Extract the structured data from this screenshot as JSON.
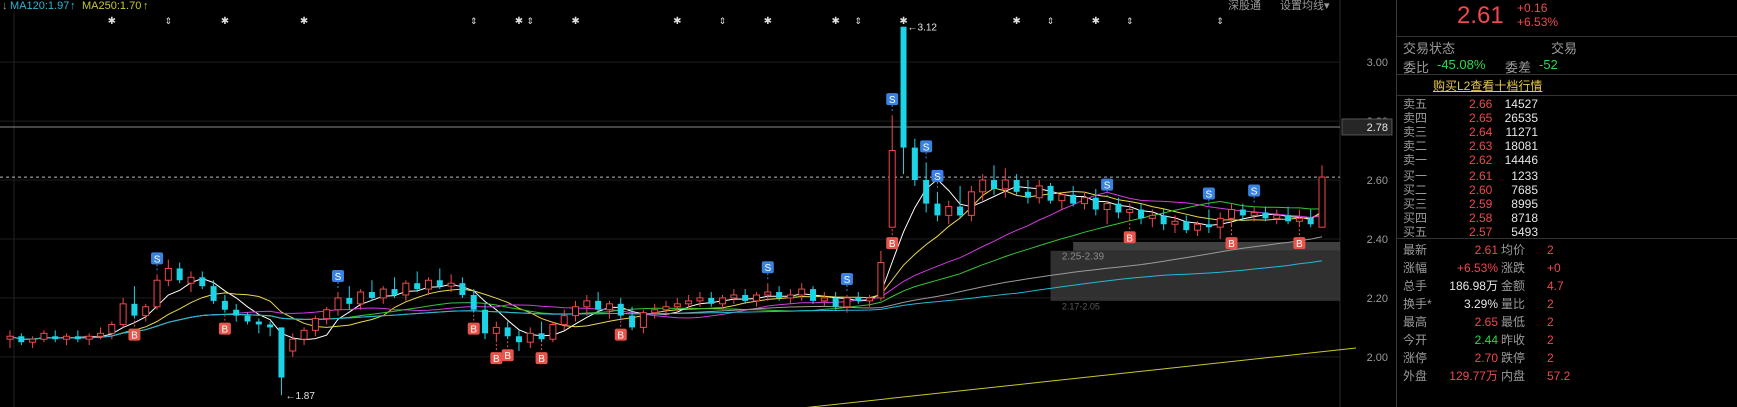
{
  "top_bar": {
    "ma120": "MA120:1.97",
    "ma120_arrow": "↑",
    "ma250": "MA250:1.70",
    "ma250_arrow": "↑",
    "left_arrow": "↓",
    "btn_deep": "深股通",
    "btn_settings": "设置均线",
    "btn_settings_caret": "▾"
  },
  "colors": {
    "up": "#f0484c",
    "down": "#1bd4e6",
    "ma_white": "#ffffff",
    "ma_yellow": "#e8d84a",
    "ma_magenta": "#d23be2",
    "ma_green": "#35c735",
    "ma_grey": "#9a9a9a",
    "ma_cyan": "#24b8d6",
    "ma_long": "#c8c82c",
    "marker_s": "#3a82e0",
    "marker_b": "#e8534a"
  },
  "chart_data": {
    "type": "candlestick",
    "y_ticks": [
      "3.00",
      "2.80",
      "2.60",
      "2.40",
      "2.20",
      "2.00"
    ],
    "y_range": [
      1.83,
      3.17
    ],
    "price_tag": "2.78",
    "annotations": {
      "high": "3.12",
      "low": "1.87",
      "box_label": "2.25-2.39",
      "cost_label": "2.17-2.05"
    },
    "bars": [
      {
        "o": 2.06,
        "h": 2.09,
        "l": 2.03,
        "c": 2.07
      },
      {
        "o": 2.07,
        "h": 2.08,
        "l": 2.04,
        "c": 2.05
      },
      {
        "o": 2.05,
        "h": 2.07,
        "l": 2.03,
        "c": 2.06
      },
      {
        "o": 2.06,
        "h": 2.09,
        "l": 2.05,
        "c": 2.08
      },
      {
        "o": 2.07,
        "h": 2.09,
        "l": 2.05,
        "c": 2.06
      },
      {
        "o": 2.06,
        "h": 2.08,
        "l": 2.04,
        "c": 2.07
      },
      {
        "o": 2.07,
        "h": 2.09,
        "l": 2.05,
        "c": 2.06
      },
      {
        "o": 2.06,
        "h": 2.08,
        "l": 2.04,
        "c": 2.07
      },
      {
        "o": 2.07,
        "h": 2.1,
        "l": 2.06,
        "c": 2.08
      },
      {
        "o": 2.08,
        "h": 2.12,
        "l": 2.06,
        "c": 2.11
      },
      {
        "o": 2.11,
        "h": 2.2,
        "l": 2.1,
        "c": 2.18
      },
      {
        "o": 2.18,
        "h": 2.24,
        "l": 2.13,
        "c": 2.14
      },
      {
        "o": 2.14,
        "h": 2.18,
        "l": 2.12,
        "c": 2.17
      },
      {
        "o": 2.17,
        "h": 2.28,
        "l": 2.16,
        "c": 2.26
      },
      {
        "o": 2.26,
        "h": 2.33,
        "l": 2.24,
        "c": 2.3
      },
      {
        "o": 2.3,
        "h": 2.32,
        "l": 2.25,
        "c": 2.26
      },
      {
        "o": 2.25,
        "h": 2.29,
        "l": 2.22,
        "c": 2.27
      },
      {
        "o": 2.27,
        "h": 2.29,
        "l": 2.23,
        "c": 2.24
      },
      {
        "o": 2.24,
        "h": 2.26,
        "l": 2.18,
        "c": 2.19
      },
      {
        "o": 2.19,
        "h": 2.21,
        "l": 2.15,
        "c": 2.16
      },
      {
        "o": 2.16,
        "h": 2.18,
        "l": 2.12,
        "c": 2.14
      },
      {
        "o": 2.14,
        "h": 2.15,
        "l": 2.11,
        "c": 2.12
      },
      {
        "o": 2.12,
        "h": 2.13,
        "l": 2.08,
        "c": 2.11
      },
      {
        "o": 2.11,
        "h": 2.12,
        "l": 2.07,
        "c": 2.1
      },
      {
        "o": 2.1,
        "h": 2.1,
        "l": 1.87,
        "c": 1.93
      },
      {
        "o": 2.02,
        "h": 2.08,
        "l": 2.0,
        "c": 2.06
      },
      {
        "o": 2.06,
        "h": 2.1,
        "l": 2.04,
        "c": 2.09
      },
      {
        "o": 2.09,
        "h": 2.14,
        "l": 2.07,
        "c": 2.13
      },
      {
        "o": 2.13,
        "h": 2.17,
        "l": 2.11,
        "c": 2.16
      },
      {
        "o": 2.16,
        "h": 2.22,
        "l": 2.14,
        "c": 2.2
      },
      {
        "o": 2.2,
        "h": 2.24,
        "l": 2.16,
        "c": 2.18
      },
      {
        "o": 2.18,
        "h": 2.23,
        "l": 2.16,
        "c": 2.22
      },
      {
        "o": 2.22,
        "h": 2.26,
        "l": 2.19,
        "c": 2.2
      },
      {
        "o": 2.2,
        "h": 2.24,
        "l": 2.18,
        "c": 2.23
      },
      {
        "o": 2.23,
        "h": 2.27,
        "l": 2.2,
        "c": 2.21
      },
      {
        "o": 2.21,
        "h": 2.26,
        "l": 2.19,
        "c": 2.25
      },
      {
        "o": 2.25,
        "h": 2.29,
        "l": 2.22,
        "c": 2.23
      },
      {
        "o": 2.23,
        "h": 2.27,
        "l": 2.21,
        "c": 2.26
      },
      {
        "o": 2.26,
        "h": 2.3,
        "l": 2.23,
        "c": 2.24
      },
      {
        "o": 2.24,
        "h": 2.28,
        "l": 2.22,
        "c": 2.25
      },
      {
        "o": 2.25,
        "h": 2.27,
        "l": 2.2,
        "c": 2.21
      },
      {
        "o": 2.21,
        "h": 2.23,
        "l": 2.15,
        "c": 2.16
      },
      {
        "o": 2.16,
        "h": 2.18,
        "l": 2.06,
        "c": 2.08
      },
      {
        "o": 2.08,
        "h": 2.12,
        "l": 2.05,
        "c": 2.1
      },
      {
        "o": 2.1,
        "h": 2.12,
        "l": 2.06,
        "c": 2.07
      },
      {
        "o": 2.07,
        "h": 2.09,
        "l": 2.02,
        "c": 2.05
      },
      {
        "o": 2.05,
        "h": 2.1,
        "l": 2.03,
        "c": 2.08
      },
      {
        "o": 2.08,
        "h": 2.12,
        "l": 2.05,
        "c": 2.06
      },
      {
        "o": 2.06,
        "h": 2.12,
        "l": 2.05,
        "c": 2.11
      },
      {
        "o": 2.11,
        "h": 2.16,
        "l": 2.09,
        "c": 2.14
      },
      {
        "o": 2.14,
        "h": 2.19,
        "l": 2.12,
        "c": 2.17
      },
      {
        "o": 2.17,
        "h": 2.21,
        "l": 2.14,
        "c": 2.19
      },
      {
        "o": 2.19,
        "h": 2.22,
        "l": 2.15,
        "c": 2.16
      },
      {
        "o": 2.16,
        "h": 2.19,
        "l": 2.13,
        "c": 2.18
      },
      {
        "o": 2.18,
        "h": 2.2,
        "l": 2.13,
        "c": 2.14
      },
      {
        "o": 2.14,
        "h": 2.17,
        "l": 2.09,
        "c": 2.1
      },
      {
        "o": 2.1,
        "h": 2.16,
        "l": 2.08,
        "c": 2.15
      },
      {
        "o": 2.15,
        "h": 2.18,
        "l": 2.13,
        "c": 2.16
      },
      {
        "o": 2.16,
        "h": 2.19,
        "l": 2.14,
        "c": 2.17
      },
      {
        "o": 2.17,
        "h": 2.2,
        "l": 2.15,
        "c": 2.18
      },
      {
        "o": 2.18,
        "h": 2.21,
        "l": 2.16,
        "c": 2.19
      },
      {
        "o": 2.19,
        "h": 2.22,
        "l": 2.17,
        "c": 2.2
      },
      {
        "o": 2.2,
        "h": 2.22,
        "l": 2.17,
        "c": 2.18
      },
      {
        "o": 2.18,
        "h": 2.21,
        "l": 2.16,
        "c": 2.2
      },
      {
        "o": 2.2,
        "h": 2.23,
        "l": 2.18,
        "c": 2.21
      },
      {
        "o": 2.21,
        "h": 2.23,
        "l": 2.18,
        "c": 2.19
      },
      {
        "o": 2.19,
        "h": 2.22,
        "l": 2.17,
        "c": 2.21
      },
      {
        "o": 2.21,
        "h": 2.25,
        "l": 2.19,
        "c": 2.22
      },
      {
        "o": 2.22,
        "h": 2.24,
        "l": 2.19,
        "c": 2.2
      },
      {
        "o": 2.2,
        "h": 2.23,
        "l": 2.18,
        "c": 2.21
      },
      {
        "o": 2.21,
        "h": 2.25,
        "l": 2.19,
        "c": 2.23
      },
      {
        "o": 2.23,
        "h": 2.24,
        "l": 2.18,
        "c": 2.19
      },
      {
        "o": 2.19,
        "h": 2.22,
        "l": 2.17,
        "c": 2.2
      },
      {
        "o": 2.2,
        "h": 2.22,
        "l": 2.16,
        "c": 2.17
      },
      {
        "o": 2.17,
        "h": 2.21,
        "l": 2.15,
        "c": 2.2
      },
      {
        "o": 2.2,
        "h": 2.22,
        "l": 2.18,
        "c": 2.19
      },
      {
        "o": 2.19,
        "h": 2.21,
        "l": 2.17,
        "c": 2.2
      },
      {
        "o": 2.2,
        "h": 2.36,
        "l": 2.19,
        "c": 2.32
      },
      {
        "o": 2.44,
        "h": 2.82,
        "l": 2.44,
        "c": 2.7
      },
      {
        "o": 3.12,
        "h": 3.12,
        "l": 2.62,
        "c": 2.71
      },
      {
        "o": 2.71,
        "h": 2.74,
        "l": 2.58,
        "c": 2.6
      },
      {
        "o": 2.6,
        "h": 2.66,
        "l": 2.49,
        "c": 2.52
      },
      {
        "o": 2.52,
        "h": 2.56,
        "l": 2.46,
        "c": 2.48
      },
      {
        "o": 2.48,
        "h": 2.53,
        "l": 2.45,
        "c": 2.51
      },
      {
        "o": 2.51,
        "h": 2.58,
        "l": 2.47,
        "c": 2.48
      },
      {
        "o": 2.48,
        "h": 2.58,
        "l": 2.46,
        "c": 2.56
      },
      {
        "o": 2.56,
        "h": 2.62,
        "l": 2.53,
        "c": 2.6
      },
      {
        "o": 2.6,
        "h": 2.65,
        "l": 2.55,
        "c": 2.57
      },
      {
        "o": 2.57,
        "h": 2.64,
        "l": 2.54,
        "c": 2.6
      },
      {
        "o": 2.6,
        "h": 2.62,
        "l": 2.55,
        "c": 2.56
      },
      {
        "o": 2.56,
        "h": 2.6,
        "l": 2.52,
        "c": 2.54
      },
      {
        "o": 2.54,
        "h": 2.6,
        "l": 2.52,
        "c": 2.58
      },
      {
        "o": 2.58,
        "h": 2.59,
        "l": 2.52,
        "c": 2.53
      },
      {
        "o": 2.53,
        "h": 2.56,
        "l": 2.5,
        "c": 2.55
      },
      {
        "o": 2.55,
        "h": 2.58,
        "l": 2.51,
        "c": 2.52
      },
      {
        "o": 2.52,
        "h": 2.56,
        "l": 2.5,
        "c": 2.54
      },
      {
        "o": 2.54,
        "h": 2.57,
        "l": 2.48,
        "c": 2.5
      },
      {
        "o": 2.5,
        "h": 2.53,
        "l": 2.45,
        "c": 2.52
      },
      {
        "o": 2.52,
        "h": 2.54,
        "l": 2.47,
        "c": 2.49
      },
      {
        "o": 2.49,
        "h": 2.52,
        "l": 2.46,
        "c": 2.5
      },
      {
        "o": 2.5,
        "h": 2.52,
        "l": 2.45,
        "c": 2.47
      },
      {
        "o": 2.47,
        "h": 2.5,
        "l": 2.44,
        "c": 2.48
      },
      {
        "o": 2.48,
        "h": 2.5,
        "l": 2.43,
        "c": 2.45
      },
      {
        "o": 2.45,
        "h": 2.48,
        "l": 2.42,
        "c": 2.46
      },
      {
        "o": 2.46,
        "h": 2.48,
        "l": 2.42,
        "c": 2.43
      },
      {
        "o": 2.43,
        "h": 2.46,
        "l": 2.41,
        "c": 2.45
      },
      {
        "o": 2.45,
        "h": 2.5,
        "l": 2.42,
        "c": 2.44
      },
      {
        "o": 2.44,
        "h": 2.49,
        "l": 2.4,
        "c": 2.47
      },
      {
        "o": 2.47,
        "h": 2.52,
        "l": 2.44,
        "c": 2.5
      },
      {
        "o": 2.5,
        "h": 2.52,
        "l": 2.46,
        "c": 2.48
      },
      {
        "o": 2.48,
        "h": 2.51,
        "l": 2.46,
        "c": 2.49
      },
      {
        "o": 2.49,
        "h": 2.51,
        "l": 2.46,
        "c": 2.47
      },
      {
        "o": 2.47,
        "h": 2.5,
        "l": 2.45,
        "c": 2.48
      },
      {
        "o": 2.48,
        "h": 2.51,
        "l": 2.45,
        "c": 2.46
      },
      {
        "o": 2.46,
        "h": 2.5,
        "l": 2.44,
        "c": 2.47
      },
      {
        "o": 2.47,
        "h": 2.5,
        "l": 2.44,
        "c": 2.45
      },
      {
        "o": 2.44,
        "h": 2.65,
        "l": 2.44,
        "c": 2.61
      }
    ],
    "markers_s": [
      13,
      29,
      67,
      74,
      78,
      81,
      82,
      97,
      106,
      110
    ],
    "markers_b": [
      11,
      19,
      41,
      43,
      44,
      47,
      54,
      78,
      99,
      108,
      114
    ],
    "star_markers": [
      9,
      19,
      26,
      45,
      50,
      59,
      67,
      73,
      79,
      89,
      96
    ],
    "tick_markers": [
      14,
      41,
      46,
      63,
      75,
      92,
      99,
      107
    ]
  },
  "quote": {
    "last": "2.61",
    "chg": "+0.16",
    "chg_pct": "+6.53%",
    "status_label": "交易状态",
    "status_right": "交易",
    "wb_label": "委比",
    "wb_value": "-45.08%",
    "wc_label": "委差",
    "wc_value": "-52",
    "l2_link": "购买L2查看十档行情",
    "asks": [
      {
        "label": "卖五",
        "price": "2.66",
        "vol": "14527"
      },
      {
        "label": "卖四",
        "price": "2.65",
        "vol": "26535"
      },
      {
        "label": "卖三",
        "price": "2.64",
        "vol": "11271"
      },
      {
        "label": "卖二",
        "price": "2.63",
        "vol": "18081"
      },
      {
        "label": "卖一",
        "price": "2.62",
        "vol": "14446"
      }
    ],
    "bids": [
      {
        "label": "买一",
        "price": "2.61",
        "vol": "1233"
      },
      {
        "label": "买二",
        "price": "2.60",
        "vol": "7685"
      },
      {
        "label": "买三",
        "price": "2.59",
        "vol": "8995"
      },
      {
        "label": "买四",
        "price": "2.58",
        "vol": "8718"
      },
      {
        "label": "买五",
        "price": "2.57",
        "vol": "5493"
      }
    ],
    "stats": [
      {
        "l1": "最新",
        "v1": "2.61",
        "c1": "red",
        "l2": "均价",
        "v2": "2"
      },
      {
        "l1": "涨幅",
        "v1": "+6.53%",
        "c1": "red",
        "l2": "涨跌",
        "v2": "+0"
      },
      {
        "l1": "总手",
        "v1": "186.98万",
        "c1": "white",
        "l2": "金额",
        "v2": "4.7"
      },
      {
        "l1": "换手*",
        "v1": "3.29%",
        "c1": "white",
        "l2": "量比",
        "v2": "2"
      },
      {
        "l1": "最高",
        "v1": "2.65",
        "c1": "red",
        "l2": "最低",
        "v2": "2"
      },
      {
        "l1": "今开",
        "v1": "2.44",
        "c1": "green",
        "l2": "昨收",
        "v2": "2"
      },
      {
        "l1": "涨停",
        "v1": "2.70",
        "c1": "red",
        "l2": "跌停",
        "v2": "2"
      },
      {
        "l1": "外盘",
        "v1": "129.77万",
        "c1": "red",
        "l2": "内盘",
        "v2": "57.2"
      }
    ]
  }
}
